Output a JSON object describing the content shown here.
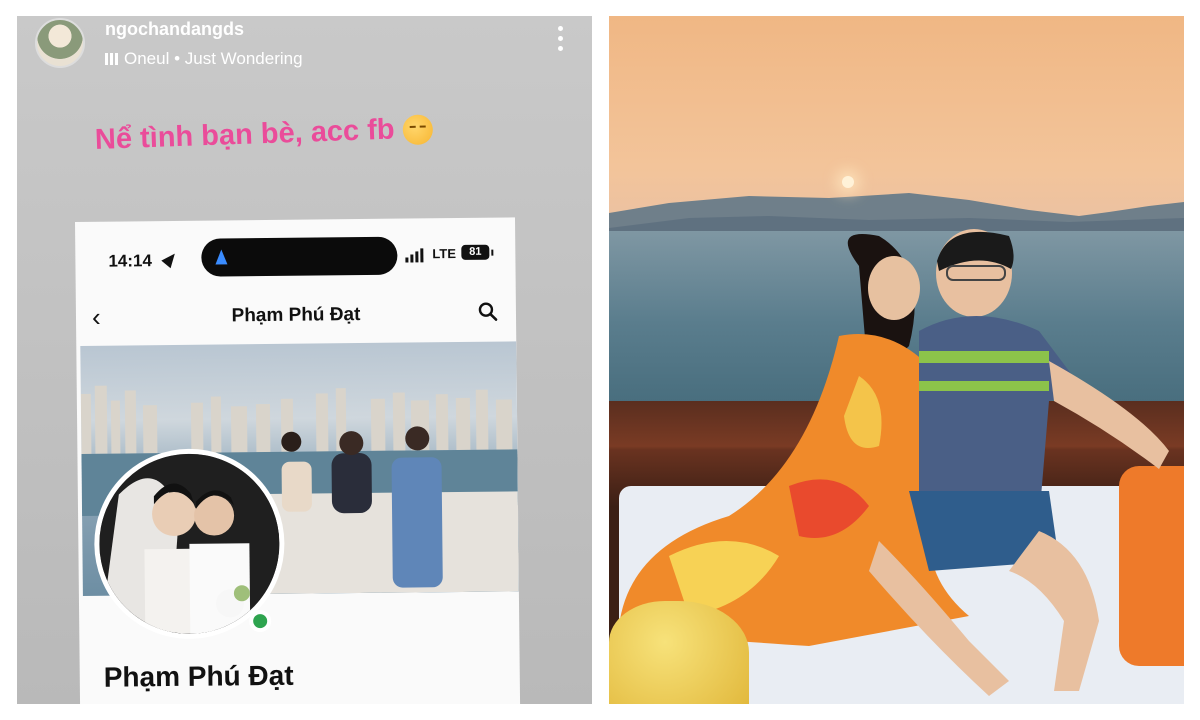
{
  "story": {
    "username": "ngochandangds",
    "music": "Oneul • Just Wondering",
    "caption": "Nể tình bạn bè, acc fb",
    "phone": {
      "status_time": "14:14",
      "network": "LTE",
      "battery": "81",
      "profile_title": "Phạm Phú Đạt",
      "profile_name": "Phạm Phú Đạt"
    }
  },
  "photo": {
    "scene": "Couple sitting on a boat at sunset"
  }
}
